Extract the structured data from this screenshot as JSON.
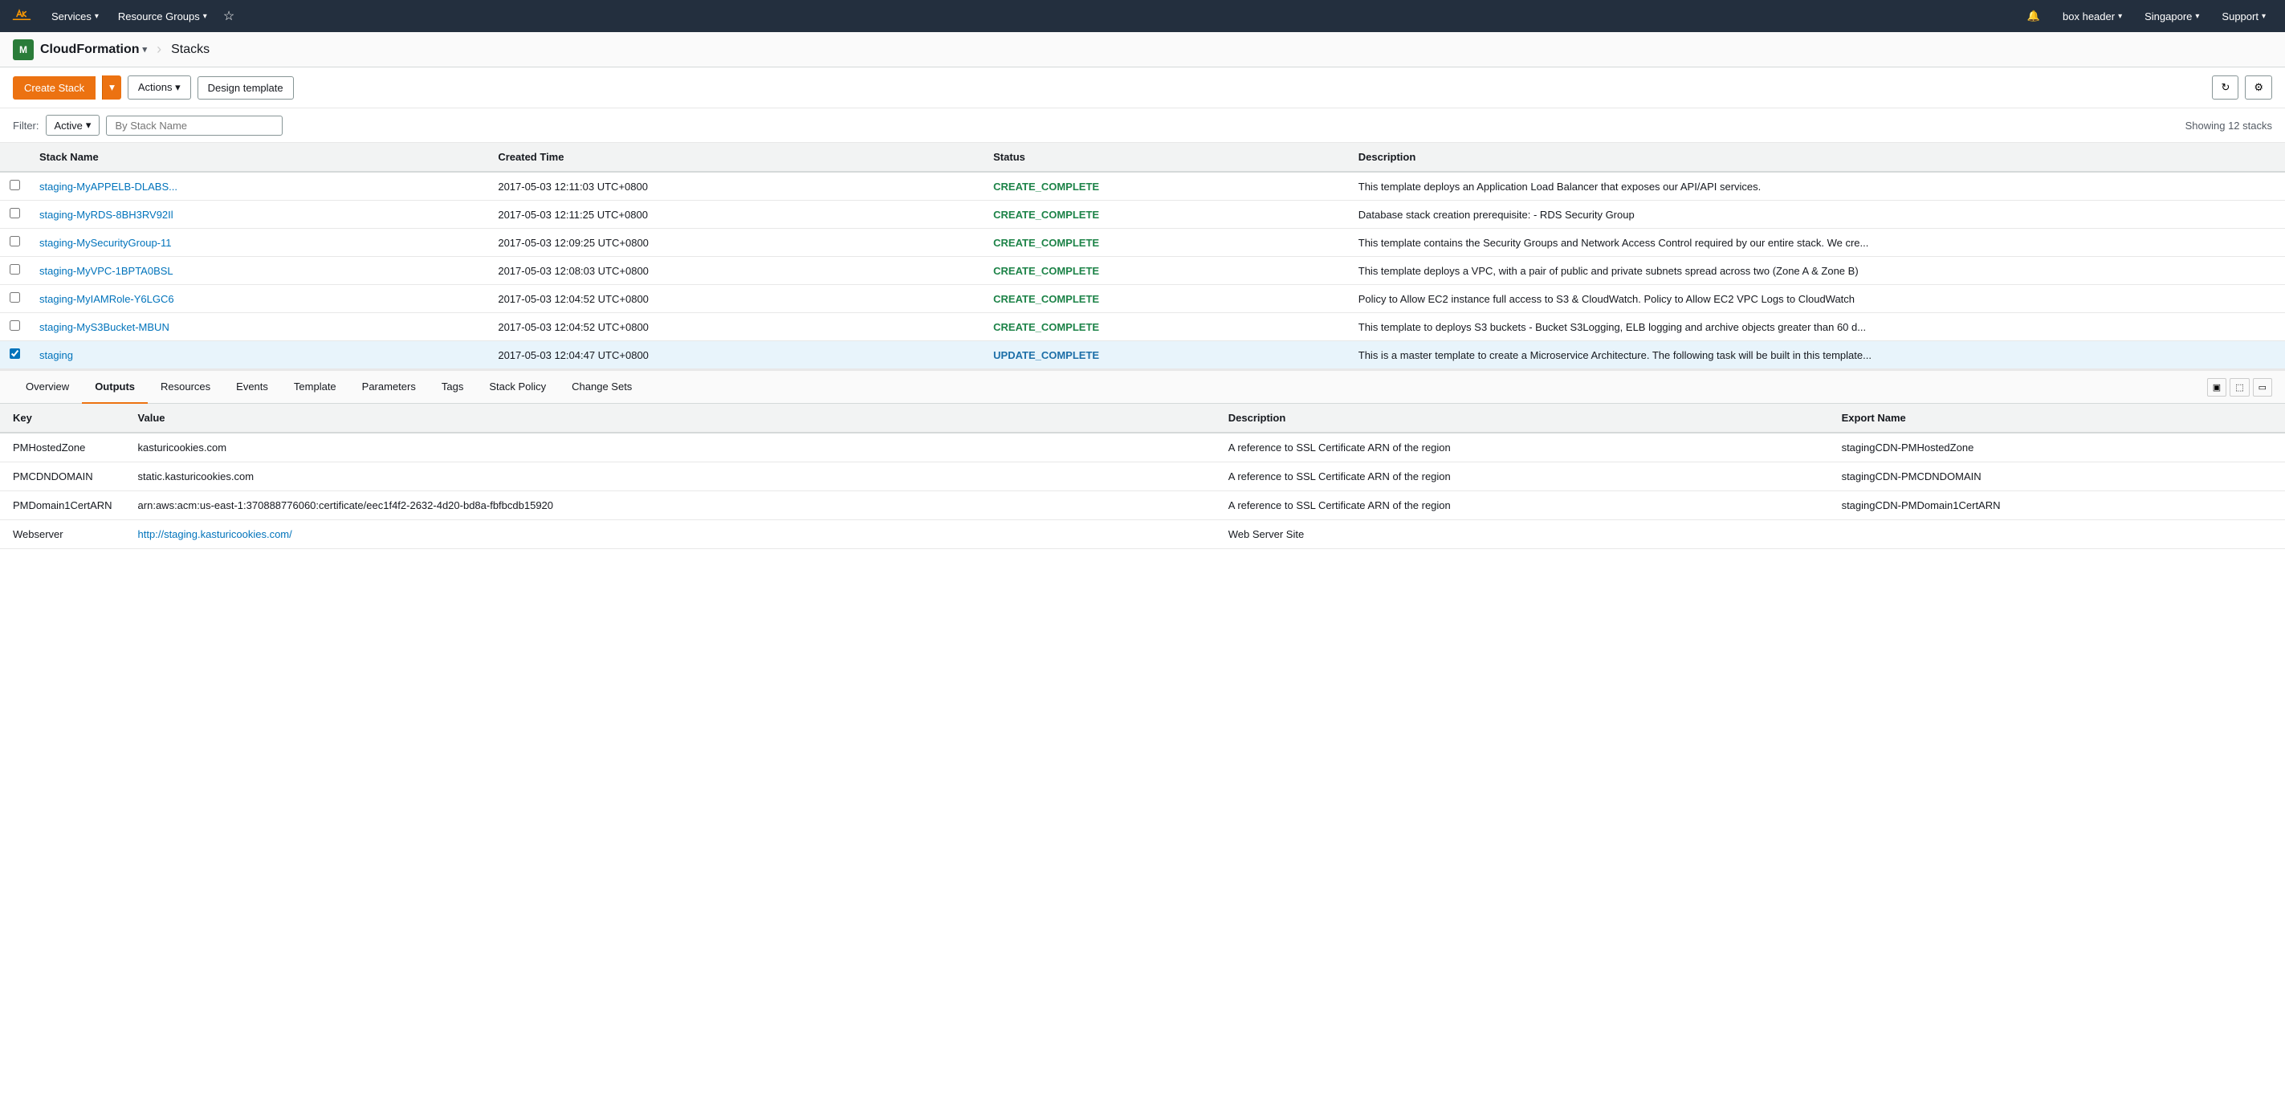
{
  "topNav": {
    "services_label": "Services",
    "resource_groups_label": "Resource Groups",
    "bell_icon": "🔔",
    "box_header_label": "box header",
    "singapore_label": "Singapore",
    "support_label": "Support"
  },
  "serviceBar": {
    "service_name": "CloudFormation",
    "stacks_label": "Stacks"
  },
  "toolbar": {
    "create_stack_label": "Create Stack",
    "actions_label": "Actions",
    "design_template_label": "Design template",
    "refresh_icon": "↻",
    "settings_icon": "⚙"
  },
  "filterBar": {
    "filter_label": "Filter:",
    "active_label": "Active",
    "placeholder": "By Stack Name",
    "showing_info": "Showing 12 stacks"
  },
  "table": {
    "columns": [
      "",
      "Stack Name",
      "Created Time",
      "Status",
      "Description"
    ],
    "rows": [
      {
        "checked": false,
        "name": "staging-MyAPPELB-DLABS...",
        "created": "2017-05-03 12:11:03 UTC+0800",
        "status": "CREATE_COMPLETE",
        "status_type": "complete",
        "description": "This template deploys an Application Load Balancer that exposes our API/API services."
      },
      {
        "checked": false,
        "name": "staging-MyRDS-8BH3RV92Il",
        "created": "2017-05-03 12:11:25 UTC+0800",
        "status": "CREATE_COMPLETE",
        "status_type": "complete",
        "description": "Database stack creation prerequisite: - RDS Security Group"
      },
      {
        "checked": false,
        "name": "staging-MySecurityGroup-11",
        "created": "2017-05-03 12:09:25 UTC+0800",
        "status": "CREATE_COMPLETE",
        "status_type": "complete",
        "description": "This template contains the Security Groups and Network Access Control required by our entire stack. We cre..."
      },
      {
        "checked": false,
        "name": "staging-MyVPC-1BPTA0BSL",
        "created": "2017-05-03 12:08:03 UTC+0800",
        "status": "CREATE_COMPLETE",
        "status_type": "complete",
        "description": "This template deploys a VPC, with a pair of public and private subnets spread across two (Zone A & Zone B)"
      },
      {
        "checked": false,
        "name": "staging-MyIAMRole-Y6LGC6",
        "created": "2017-05-03 12:04:52 UTC+0800",
        "status": "CREATE_COMPLETE",
        "status_type": "complete",
        "description": "Policy to Allow EC2 instance full access to S3 & CloudWatch. Policy to Allow EC2 VPC Logs to CloudWatch"
      },
      {
        "checked": false,
        "name": "staging-MyS3Bucket-MBUN",
        "created": "2017-05-03 12:04:52 UTC+0800",
        "status": "CREATE_COMPLETE",
        "status_type": "complete",
        "description": "This template to deploys S3 buckets - Bucket S3Logging, ELB logging and archive objects greater than 60 d..."
      },
      {
        "checked": true,
        "name": "staging",
        "created": "2017-05-03 12:04:47 UTC+0800",
        "status": "UPDATE_COMPLETE",
        "status_type": "update",
        "description": "This is a master template to create a Microservice Architecture. The following task will be built in this template..."
      }
    ]
  },
  "detailPanel": {
    "tabs": [
      "Overview",
      "Outputs",
      "Resources",
      "Events",
      "Template",
      "Parameters",
      "Tags",
      "Stack Policy",
      "Change Sets"
    ],
    "active_tab": "Outputs",
    "outputs": {
      "columns": [
        "Key",
        "Value",
        "Description",
        "Export Name"
      ],
      "rows": [
        {
          "key": "PMHostedZone",
          "value": "kasturicookies.com",
          "value_type": "text",
          "description": "A reference to SSL Certificate ARN of the region",
          "export_name": "stagingCDN-PMHostedZone"
        },
        {
          "key": "PMCDNDOMAIN",
          "value": "static.kasturicookies.com",
          "value_type": "text",
          "description": "A reference to SSL Certificate ARN of the region",
          "export_name": "stagingCDN-PMCDNDOMAIN"
        },
        {
          "key": "PMDomain1CertARN",
          "value": "arn:aws:acm:us-east-1:370888776060:certificate/eec1f4f2-2632-4d20-bd8a-fbfbcdb15920",
          "value_type": "text",
          "description": "A reference to SSL Certificate ARN of the region",
          "export_name": "stagingCDN-PMDomain1CertARN"
        },
        {
          "key": "Webserver",
          "value": "http://staging.kasturicookies.com/",
          "value_type": "link",
          "description": "Web Server Site",
          "export_name": ""
        }
      ]
    }
  }
}
